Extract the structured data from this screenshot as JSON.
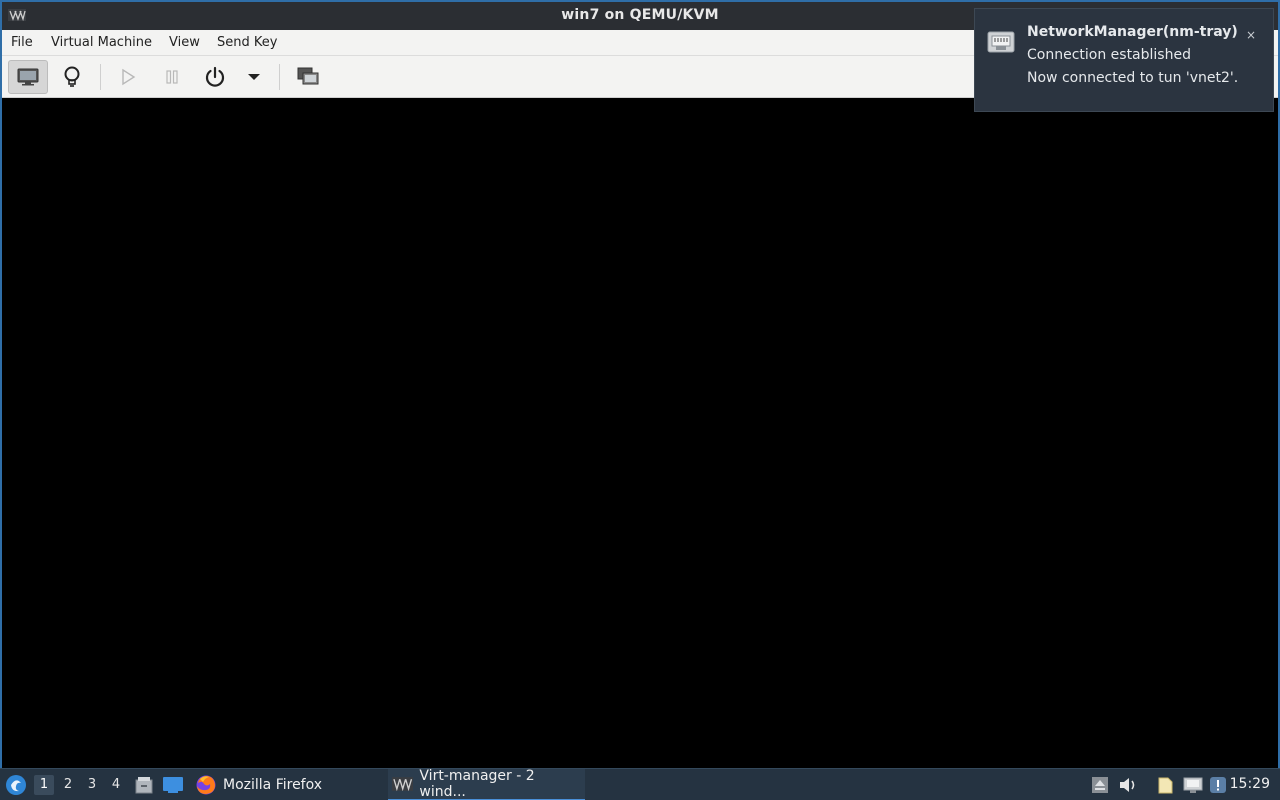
{
  "window": {
    "title": "win7 on QEMU/KVM",
    "menu": [
      "File",
      "Virtual Machine",
      "View",
      "Send Key"
    ]
  },
  "toolbar": {
    "buttons": [
      {
        "name": "console-view",
        "icon": "monitor-icon",
        "active": true
      },
      {
        "name": "details-view",
        "icon": "lightbulb-icon",
        "active": false
      },
      {
        "name": "run",
        "icon": "play-icon",
        "enabled": false
      },
      {
        "name": "pause",
        "icon": "pause-icon",
        "enabled": false
      },
      {
        "name": "shutdown",
        "icon": "power-icon"
      },
      {
        "name": "shutdown-menu",
        "icon": "chevron-down-icon"
      },
      {
        "name": "fullscreen",
        "icon": "fullscreen-icon"
      }
    ]
  },
  "notification": {
    "title": "NetworkManager(nm-tray)",
    "line1": "Connection established",
    "line2": "Now connected to tun 'vnet2'.",
    "close": "×"
  },
  "taskbar": {
    "desktops": [
      "1",
      "2",
      "3",
      "4"
    ],
    "active_desktop": "1",
    "tasks": [
      {
        "label": "Mozilla Firefox",
        "icon": "firefox-icon"
      },
      {
        "label": "Virt-manager - 2 wind...",
        "icon": "virt-manager-icon",
        "active": true
      }
    ],
    "clock": "15:29"
  },
  "colors": {
    "title_bar": "#2b2e33",
    "taskbar": "#253341",
    "notification": "#2b3440",
    "accent": "#4a90d9"
  }
}
